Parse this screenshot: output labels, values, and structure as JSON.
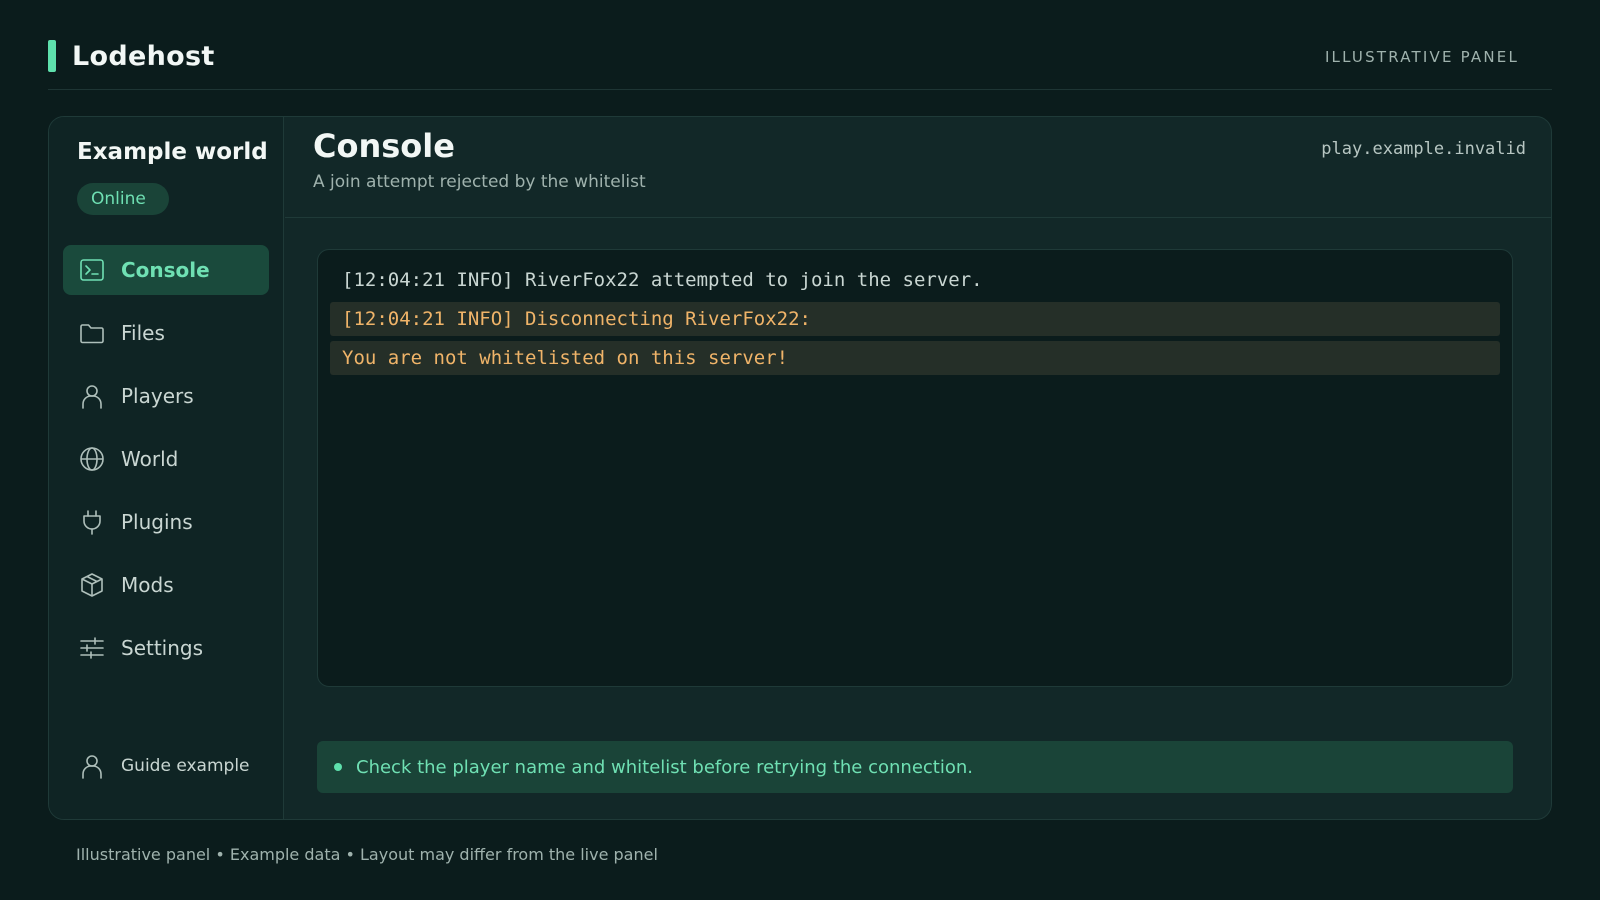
{
  "app": {
    "brand": "Lodehost",
    "tag": "ILLUSTRATIVE PANEL"
  },
  "colors": {
    "accent": "#5ee0ac",
    "warning": "#f0b469",
    "background": "#0b1c1c"
  },
  "sidebar": {
    "world_name": "Example world",
    "status": "Online",
    "items": [
      {
        "label": "Console",
        "icon": "terminal-icon",
        "active": true
      },
      {
        "label": "Files",
        "icon": "folder-icon",
        "active": false
      },
      {
        "label": "Players",
        "icon": "user-icon",
        "active": false
      },
      {
        "label": "World",
        "icon": "globe-icon",
        "active": false
      },
      {
        "label": "Plugins",
        "icon": "plug-icon",
        "active": false
      },
      {
        "label": "Mods",
        "icon": "package-icon",
        "active": false
      },
      {
        "label": "Settings",
        "icon": "sliders-icon",
        "active": false
      }
    ],
    "guide": {
      "label": "Guide example",
      "icon": "user-icon"
    }
  },
  "main": {
    "title": "Console",
    "subtitle": "A join attempt rejected by the whitelist",
    "host": "play.example.invalid",
    "console_lines": [
      {
        "text": "[12:04:21 INFO] RiverFox22 attempted to join the server.",
        "level": "info"
      },
      {
        "text": "[12:04:21 INFO] Disconnecting RiverFox22:",
        "level": "warn"
      },
      {
        "text": "You are not whitelisted on this server!",
        "level": "warn"
      }
    ],
    "hint": "Check the player name and whitelist before retrying the connection."
  },
  "footer": "Illustrative panel • Example data • Layout may differ from the live panel"
}
